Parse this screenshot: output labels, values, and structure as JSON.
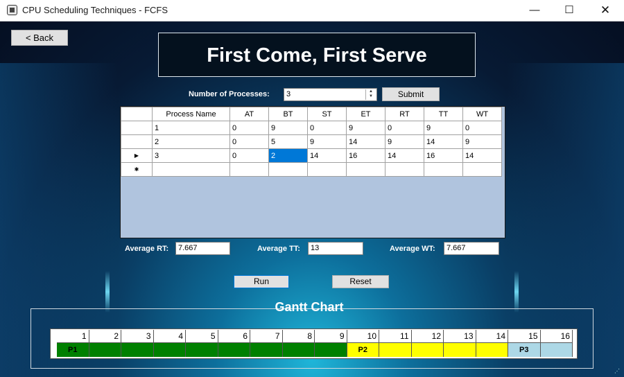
{
  "window": {
    "title": "CPU Scheduling Techniques - FCFS",
    "minimize_glyph": "—",
    "maximize_glyph": "☐",
    "close_glyph": "✕"
  },
  "back_button": "< Back",
  "heading": "First Come, First Serve",
  "process_input": {
    "label": "Number of Processes:",
    "value": "3",
    "submit_label": "Submit"
  },
  "grid": {
    "columns": [
      "Process Name",
      "AT",
      "BT",
      "ST",
      "ET",
      "RT",
      "TT",
      "WT"
    ],
    "rows": [
      [
        "1",
        "0",
        "9",
        "0",
        "9",
        "0",
        "9",
        "0"
      ],
      [
        "2",
        "0",
        "5",
        "9",
        "14",
        "9",
        "14",
        "9"
      ],
      [
        "3",
        "0",
        "2",
        "14",
        "16",
        "14",
        "16",
        "14"
      ]
    ],
    "current_row_marker": "▶",
    "new_row_marker": "✱",
    "selected_cell": {
      "row": 2,
      "col": 2
    }
  },
  "averages": {
    "rt_label": "Average RT:",
    "rt_value": "7.667",
    "tt_label": "Average TT:",
    "tt_value": "13",
    "wt_label": "Average WT:",
    "wt_value": "7.667"
  },
  "run_label": "Run",
  "reset_label": "Reset",
  "gantt": {
    "title": "Gantt Chart",
    "ticks": [
      "1",
      "2",
      "3",
      "4",
      "5",
      "6",
      "7",
      "8",
      "9",
      "10",
      "11",
      "12",
      "13",
      "14",
      "15",
      "16"
    ],
    "blocks": [
      {
        "label": "P1",
        "start": 0,
        "end": 9,
        "color": "#008000"
      },
      {
        "label": "P2",
        "start": 9,
        "end": 14,
        "color": "#ffff00"
      },
      {
        "label": "P3",
        "start": 14,
        "end": 16,
        "color": "#add8e6"
      }
    ]
  },
  "colors": {
    "selection": "#0078d7",
    "grid_background": "#b0c4de"
  }
}
